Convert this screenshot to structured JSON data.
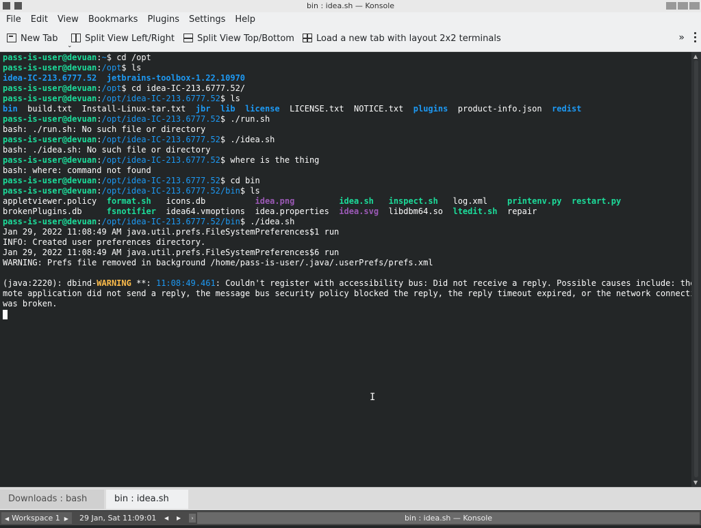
{
  "window": {
    "title": "bin : idea.sh — Konsole"
  },
  "menu": [
    "File",
    "Edit",
    "View",
    "Bookmarks",
    "Plugins",
    "Settings",
    "Help"
  ],
  "toolbar": {
    "new_tab": "New Tab",
    "split_lr": "Split View Left/Right",
    "split_tb": "Split View Top/Bottom",
    "load_layout": "Load a new tab with layout 2x2 terminals",
    "overflow": "»"
  },
  "terminal": {
    "user": "pass-is-user@devuan",
    "l1_path": "~",
    "l1_cmd": " cd /opt",
    "l2_path": "/opt",
    "l2_cmd": " ls",
    "l3_a": "idea-IC-213.6777.52",
    "l3_b": "jetbrains-toolbox-1.22.10970",
    "l4_path": "/opt",
    "l4_cmd": " cd idea-IC-213.6777.52/",
    "l5_path": "/opt/idea-IC-213.6777.52",
    "l5_cmd": " ls",
    "ls1": [
      "bin",
      "build.txt",
      "Install-Linux-tar.txt",
      "jbr",
      "lib",
      "license",
      "LICENSE.txt",
      "NOTICE.txt",
      "plugins",
      "product-info.json",
      "redist"
    ],
    "l7_path": "/opt/idea-IC-213.6777.52",
    "l7_cmd": " ./run.sh",
    "l8": "bash: ./run.sh: No such file or directory",
    "l9_path": "/opt/idea-IC-213.6777.52",
    "l9_cmd": " ./idea.sh",
    "l10": "bash: ./idea.sh: No such file or directory",
    "l11_path": "/opt/idea-IC-213.6777.52",
    "l11_cmd": " where is the thing",
    "l12": "bash: where: command not found",
    "l13_path": "/opt/idea-IC-213.6777.52",
    "l13_cmd": " cd bin",
    "l14_path": "/opt/idea-IC-213.6777.52/bin",
    "l14_cmd": " ls",
    "ls2": [
      "appletviewer.policy",
      "format.sh",
      "icons.db",
      "idea.png",
      "idea.sh",
      "inspect.sh",
      "log.xml",
      "printenv.py",
      "restart.py",
      "brokenPlugins.db",
      "fsnotifier",
      "idea64.vmoptions",
      "idea.properties",
      "idea.svg",
      "libdbm64.so",
      "ltedit.sh",
      "repair"
    ],
    "l17_path": "/opt/idea-IC-213.6777.52/bin",
    "l17_cmd": " ./idea.sh",
    "l18": "Jan 29, 2022 11:08:49 AM java.util.prefs.FileSystemPreferences$1 run",
    "l19": "INFO: Created user preferences directory.",
    "l20": "Jan 29, 2022 11:08:49 AM java.util.prefs.FileSystemPreferences$6 run",
    "l21": "WARNING: Prefs file removed in background /home/pass-is-user/.java/.userPrefs/prefs.xml",
    "l23_a": "(java:2220): dbind-",
    "l23_warn": "WARNING",
    "l23_b": " **: ",
    "l23_time": "11:08:49.461",
    "l23_c": ": Couldn't register with accessibility bus: Did not receive a reply. Possible causes include: the re",
    "l24": "mote application did not send a reply, the message bus security policy blocked the reply, the reply timeout expired, or the network connection",
    "l25": "was broken."
  },
  "tabs": [
    {
      "label": "Downloads : bash"
    },
    {
      "label": "bin : idea.sh"
    }
  ],
  "panel": {
    "workspace": "Workspace 1",
    "clock": "29 Jan, Sat 11:09:01",
    "task": "bin : idea.sh — Konsole"
  }
}
